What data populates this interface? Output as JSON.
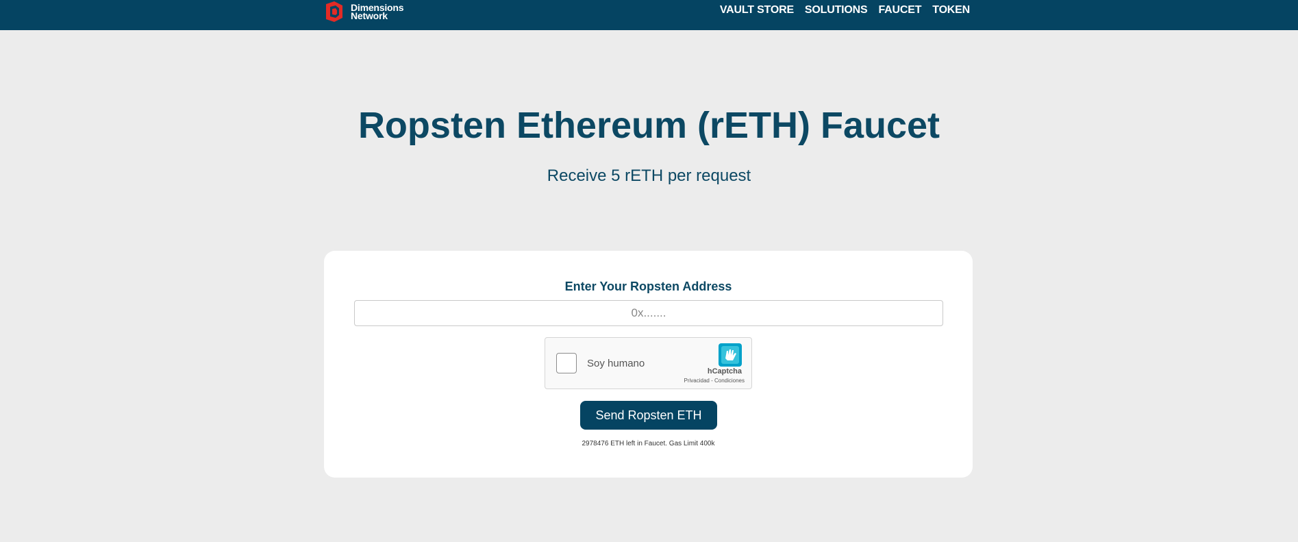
{
  "header": {
    "brand_line1": "Dimensions",
    "brand_line2": "Network",
    "nav": [
      {
        "label": "VAULT STORE"
      },
      {
        "label": "SOLUTIONS"
      },
      {
        "label": "FAUCET"
      },
      {
        "label": "TOKEN"
      }
    ]
  },
  "hero": {
    "title": "Ropsten Ethereum (rETH) Faucet",
    "subtitle": "Receive 5 rETH per request"
  },
  "form": {
    "label": "Enter Your Ropsten Address",
    "address_placeholder": "0x.......",
    "address_value": "",
    "captcha": {
      "label": "Soy humano",
      "brand": "hCaptcha",
      "links": "Privacidad - Condiciones",
      "checked": false
    },
    "submit_label": "Send Ropsten ETH",
    "info": "2978476 ETH left in Faucet. Gas Limit 400k"
  },
  "colors": {
    "primary": "#054462",
    "title": "#0c4863",
    "background": "#ececec",
    "logo_red": "#e32b26",
    "captcha_teal": "#00a1c9"
  }
}
